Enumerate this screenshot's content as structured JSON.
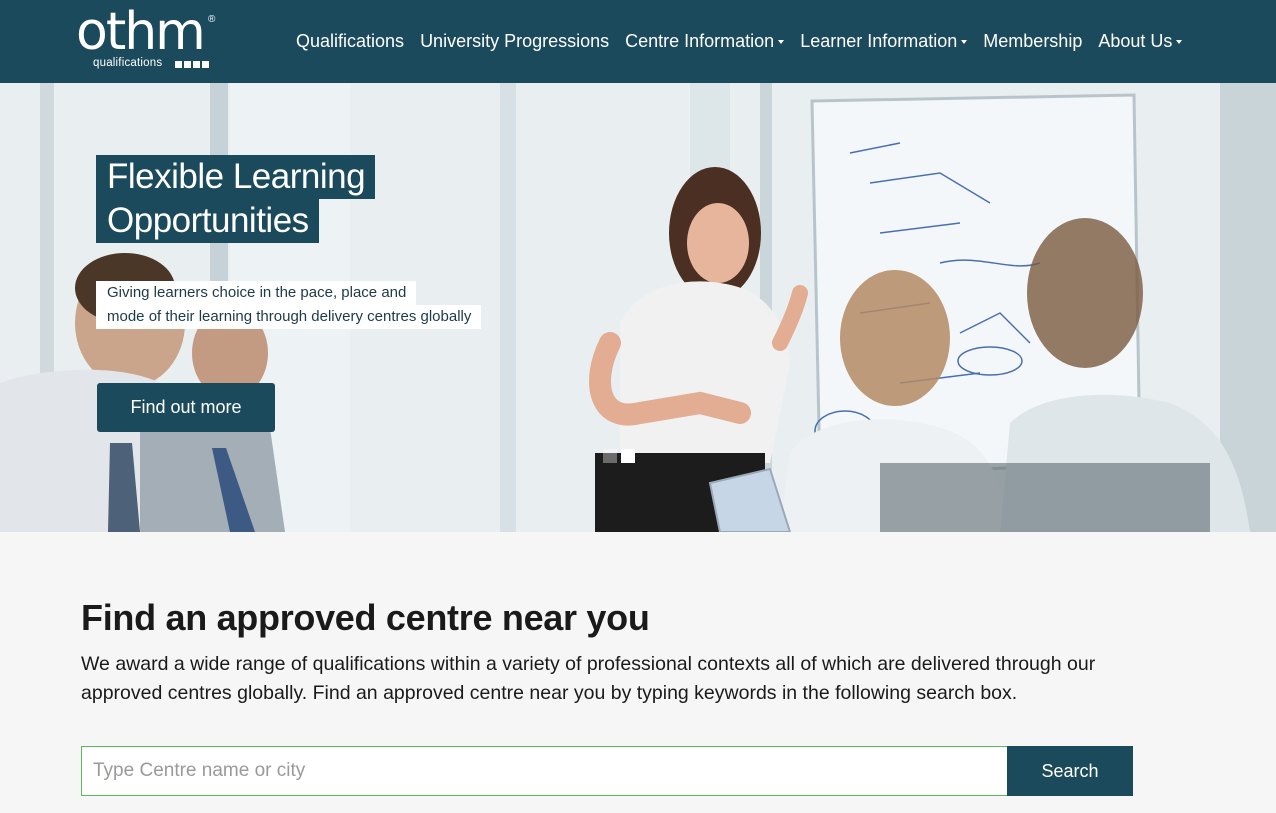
{
  "brand": {
    "logo_word": "othm",
    "logo_sub": "qualifications",
    "registered": "®",
    "colors": {
      "primary": "#1c4a5d",
      "accent_border": "#5cb85c",
      "background": "#f6f6f6"
    }
  },
  "nav": {
    "items": [
      {
        "label": "Qualifications",
        "dropdown": false
      },
      {
        "label": "University Progressions",
        "dropdown": false
      },
      {
        "label": "Centre Information",
        "dropdown": true
      },
      {
        "label": "Learner Information",
        "dropdown": true
      },
      {
        "label": "Membership",
        "dropdown": false
      },
      {
        "label": "About Us",
        "dropdown": true
      }
    ]
  },
  "hero": {
    "title_line1": "Flexible Learning",
    "title_line2": "Opportunities",
    "subtitle_line1": "Giving learners choice in the pace, place and",
    "subtitle_line2": "mode of their learning through delivery centres globally",
    "button_label": "Find out more",
    "slides_count": 2,
    "active_slide": 2
  },
  "finder": {
    "title": "Find an approved centre near you",
    "description": "We award a wide range of qualifications within a variety of professional contexts all of which are delivered through our approved centres globally. Find an approved centre near you by typing keywords in the following search box.",
    "placeholder": "Type Centre name or city",
    "value": "",
    "button_label": "Search"
  }
}
